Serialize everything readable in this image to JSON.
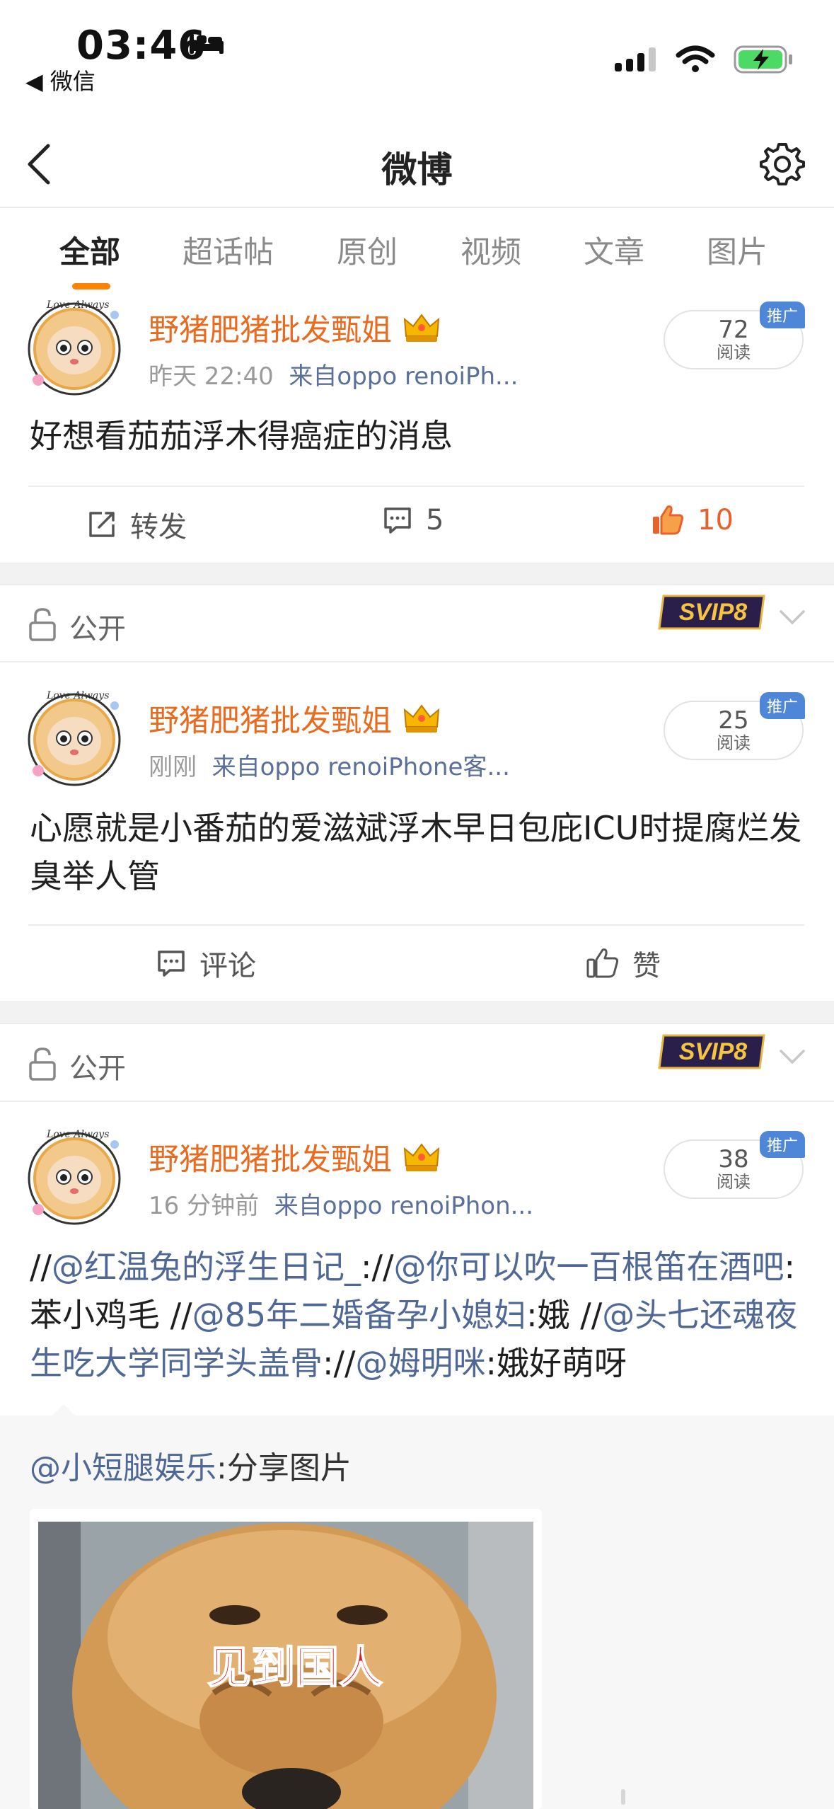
{
  "status_bar": {
    "time": "03:46",
    "back_app": "◀ 微信"
  },
  "nav": {
    "title": "微博"
  },
  "tabs": [
    "全部",
    "超话帖",
    "原创",
    "视频",
    "文章",
    "图片"
  ],
  "colors": {
    "accent": "#ff8200",
    "username": "#e86b1f",
    "mention": "#506896",
    "liked": "#e8612c",
    "promo_badge": "#4e86d8"
  },
  "posts": [
    {
      "username": "野猪肥猪批发甄姐",
      "time": "昨天 22:40",
      "source": "来自oppo renoiPh...",
      "reads": "72",
      "reads_label": "阅读",
      "promo": "推广",
      "text": "好想看茄茄浮木得癌症的消息",
      "actions": {
        "repost": "转发",
        "comments": "5",
        "likes": "10"
      }
    },
    {
      "visibility": "公开",
      "svip": "SVIP8",
      "username": "野猪肥猪批发甄姐",
      "time": "刚刚",
      "source": "来自oppo renoiPhone客...",
      "reads": "25",
      "reads_label": "阅读",
      "promo": "推广",
      "text": "心愿就是小番茄的爱滋斌浮木早日包庇ICU时提腐烂发臭举人管",
      "actions": {
        "comment": "评论",
        "like": "赞"
      }
    },
    {
      "visibility": "公开",
      "svip": "SVIP8",
      "username": "野猪肥猪批发甄姐",
      "time": "16 分钟前",
      "source": "来自oppo renoiPhon...",
      "reads": "38",
      "reads_label": "阅读",
      "promo": "推广",
      "text_parts": {
        "p1": "//",
        "m1": "@红温兔的浮生日记_",
        "p2": "://",
        "m2": "@你可以吹一百根笛在酒吧",
        "p3": ":苯小鸡毛 //",
        "m3": "@85年二婚备孕小媳妇",
        "p4": ":娥 //",
        "m4": "@头七还魂夜生吃大学同学头盖骨",
        "p5": "://",
        "m5": "@姆明咪",
        "p6": ":娥好萌呀"
      },
      "repost": {
        "author": "@小短腿娱乐",
        "text": ":分享图片",
        "image_caption": "见到国人"
      }
    }
  ]
}
